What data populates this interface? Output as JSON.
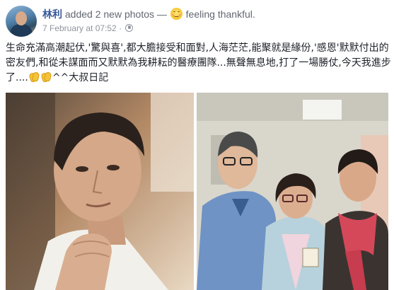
{
  "post": {
    "author": "林利",
    "action": "added 2 new photos — ",
    "feeling": "feeling thankful.",
    "feeling_icon": "smiling-face-icon",
    "timestamp": "7 February at 07:52",
    "separator": " · ",
    "privacy_icon": "globe-icon",
    "text_part1": "生命充滿高潮起伏,'驚與喜',都大膽接受和面對,人海茫茫,能聚就是緣份,'感恩'默默付出的密友們,和從未謀面而又默默為我耕耘的醫療團隊...無聲無息地,打了一場勝仗,今天我進步了....",
    "text_part2": "^^大叔日記",
    "clap_icon": "clapping-hands-icon"
  },
  "colors": {
    "author_link": "#365899",
    "meta_text": "#90949c",
    "body_text": "#1d2129"
  }
}
